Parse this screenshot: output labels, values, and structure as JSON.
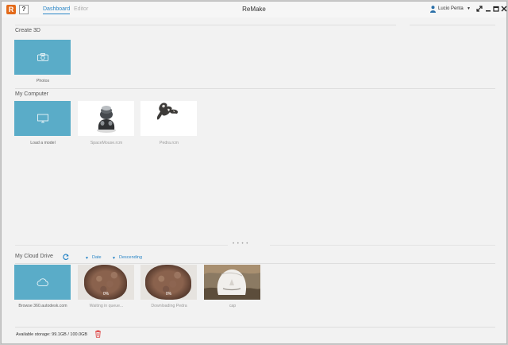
{
  "titlebar": {
    "logo_letter": "R",
    "help_label": "?",
    "tabs": [
      "Dashboard",
      "Editor"
    ],
    "title": "ReMake",
    "user": "Lucio Penta",
    "user_caret": "▼"
  },
  "create3d": {
    "title": "Create 3D",
    "tiles": [
      {
        "caption": "Photos",
        "icon": "camera-icon"
      }
    ]
  },
  "my_computer": {
    "title": "My Computer",
    "tiles": [
      {
        "caption": "Load a model",
        "icon": "monitor-icon"
      },
      {
        "caption": "SpaceMouse.rcm"
      },
      {
        "caption": "Pedra.rcm"
      }
    ]
  },
  "splitter_dots": "• • • •",
  "cloud": {
    "title": "My Cloud Drive",
    "sort_field": "Date",
    "sort_order": "Descending",
    "tiles": [
      {
        "caption": "Browse 360.autodesk.com",
        "icon": "cloud-icon"
      },
      {
        "caption": "Waiting in queue...",
        "status": "0%"
      },
      {
        "caption": "Downloading Pedra",
        "status": "0%"
      },
      {
        "caption": "cap"
      }
    ]
  },
  "storage_text": "Available storage: 99.1GB / 100.0GB",
  "colors": {
    "accent": "#2a86c7",
    "tile_blue": "#5aacc8",
    "trash": "#e05050"
  }
}
